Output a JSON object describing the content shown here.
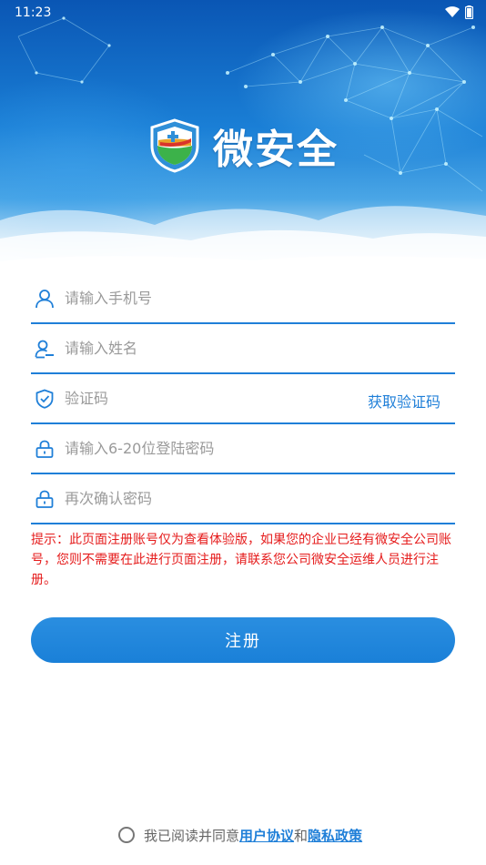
{
  "status": {
    "time": "11:23"
  },
  "app": {
    "name": "微安全"
  },
  "form": {
    "phone": {
      "placeholder": "请输入手机号"
    },
    "name": {
      "placeholder": "请输入姓名"
    },
    "code": {
      "placeholder": "验证码",
      "get_code_label": "获取验证码"
    },
    "password": {
      "placeholder": "请输入6-20位登陆密码"
    },
    "confirm_password": {
      "placeholder": "再次确认密码"
    }
  },
  "tip": "提示：此页面注册账号仅为查看体验版，如果您的企业已经有微安全公司账号，您则不需要在此进行页面注册，请联系您公司微安全运维人员进行注册。",
  "register_button": "注册",
  "agreement": {
    "prefix": "我已阅读并同意",
    "user_agreement": "用户协议",
    "and": "和",
    "privacy_policy": "隐私政策"
  },
  "colors": {
    "accent": "#1f7fd8",
    "warning": "#e51b1b"
  }
}
